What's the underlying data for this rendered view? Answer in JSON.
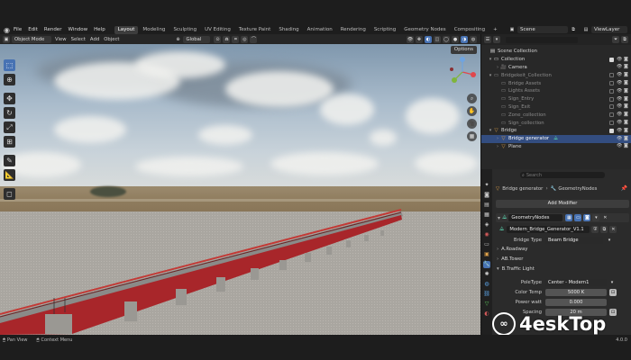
{
  "menu": {
    "items": [
      "File",
      "Edit",
      "Render",
      "Window",
      "Help"
    ],
    "workspaces": [
      "Layout",
      "Modeling",
      "Sculpting",
      "UV Editing",
      "Texture Paint",
      "Shading",
      "Animation",
      "Rendering",
      "Scripting",
      "Geometry Nodes",
      "Compositing"
    ],
    "add_tab": "+",
    "scene": "Scene",
    "view_layer": "ViewLayer"
  },
  "viewport_header": {
    "mode": "Object Mode",
    "links": [
      "View",
      "Select",
      "Add",
      "Object"
    ],
    "transform": "Global",
    "options": "Options"
  },
  "outliner": {
    "search_placeholder": "",
    "rows": [
      {
        "label": "Scene Collection",
        "icon": "scene-collection-icon",
        "dim": false
      },
      {
        "label": "Collection",
        "icon": "collection-icon",
        "dim": false
      },
      {
        "label": "Camera",
        "icon": "camera-icon",
        "dim": false
      },
      {
        "label": "Bridgekeit_Collection",
        "icon": "collection-icon",
        "dim": true
      },
      {
        "label": "Bridge Assets",
        "icon": "collection-icon",
        "dim": true
      },
      {
        "label": "Lights Assets",
        "icon": "collection-icon",
        "dim": true
      },
      {
        "label": "Sign_Entry",
        "icon": "collection-icon",
        "dim": true
      },
      {
        "label": "Sign_Exit",
        "icon": "collection-icon",
        "dim": true
      },
      {
        "label": "Zone_collection",
        "icon": "collection-icon",
        "dim": true
      },
      {
        "label": "Sign_collection",
        "icon": "collection-icon",
        "dim": true
      },
      {
        "label": "Bridge",
        "icon": "mesh-icon",
        "dim": false
      },
      {
        "label": "Bridge generator",
        "icon": "modifier-icon",
        "dim": false
      },
      {
        "label": "Plane",
        "icon": "mesh-icon",
        "dim": false
      }
    ]
  },
  "properties": {
    "search_placeholder": "Search",
    "breadcrumb_object": "Bridge generator",
    "breadcrumb_modifier": "GeometryNodes",
    "add_modifier": "Add Modifier",
    "modifier_name": "GeometryNodes",
    "node_group": "Modern_Bridge_Generator_V1.1",
    "bridge_type_label": "Bridge Type",
    "bridge_type_value": "Beam Bridge",
    "panels": [
      "A.Roadway",
      "AB.Tower",
      "B.Traffic Light"
    ],
    "pole_type_label": "PoleType",
    "pole_type_value": "Center - Modern1",
    "color_temp_label": "Color Temp",
    "color_temp_value": "5000 K",
    "power_label": "Power watt",
    "power_value": "0.000",
    "spacing_label": "Spacing",
    "spacing_value": "20 m"
  },
  "status": {
    "pan_view": "Pan View",
    "context_menu": "Context Menu",
    "version": "4.0.0"
  },
  "watermark": {
    "text": "4eskTop"
  },
  "colors": {
    "accent": "#4772b3",
    "bridge_red": "#b3262a"
  }
}
